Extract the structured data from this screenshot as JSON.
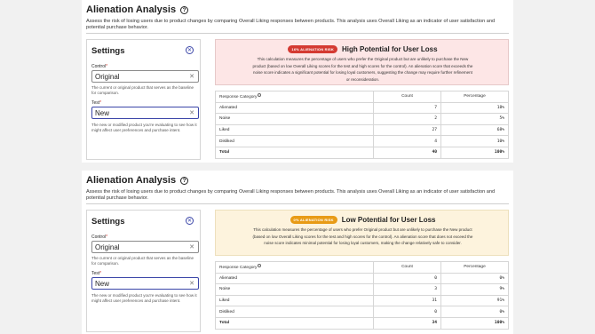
{
  "panels": [
    {
      "title": "Alienation Analysis",
      "description": "Assess the risk of losing users due to product changes by comparing Overall Liking responses between products. This analysis uses Overall Liking as an indicator of user satisfaction and potential purchase behavior.",
      "settings": {
        "title": "Settings",
        "control_label": "Control",
        "control_value": "Original",
        "control_hint": "The current or original product that serves as the baseline for comparison.",
        "test_label": "Test",
        "test_value": "New",
        "test_hint": "The new or modified product you're evaluating to see how it might affect user preferences and purchase intent."
      },
      "result": {
        "badge": "16% ALIENATION RISK",
        "headline": "High Potential for User Loss",
        "text": "This calculation measures the percentage of users who prefer the Original product but are unlikely to purchase the New product (based on low Overall Liking scores for the test and high scores for the control). An alienation score that exceeds the noise score indicates a significant potential for losing loyal customers, suggesting the change may require further refinement or reconsideration."
      },
      "table": {
        "headers": [
          "Response Category",
          "Count",
          "Percentage"
        ],
        "rows": [
          {
            "category": "Alienated",
            "count": "7",
            "pct": "18%"
          },
          {
            "category": "Noise",
            "count": "2",
            "pct": "5%"
          },
          {
            "category": "Liked",
            "count": "27",
            "pct": "68%"
          },
          {
            "category": "Disliked",
            "count": "4",
            "pct": "10%"
          },
          {
            "category": "Total",
            "count": "40",
            "pct": "100%"
          }
        ]
      }
    },
    {
      "title": "Alienation Analysis",
      "description": "Assess the risk of losing users due to product changes by comparing Overall Liking responses between products. This analysis uses Overall Liking as an indicator of user satisfaction and potential purchase behavior.",
      "settings": {
        "title": "Settings",
        "control_label": "Control",
        "control_value": "Original",
        "control_hint": "The current or original product that serves as the baseline for comparison.",
        "test_label": "Test",
        "test_value": "New",
        "test_hint": "The new or modified product you're evaluating to see how it might affect user preferences and purchase intent."
      },
      "result": {
        "badge": "0% ALIENATION RISK",
        "headline": "Low Potential for User Loss",
        "text": "This calculation measures the percentage of users who prefer Original product but are unlikely to purchase the New product (based on low Overall Liking scores for the test and high scores for the control). An alienation score that does not exceed the noise score indicates minimal potential for losing loyal customers, making the change relatively safe to consider."
      },
      "table": {
        "headers": [
          "Response Category",
          "Count",
          "Percentage"
        ],
        "rows": [
          {
            "category": "Alienated",
            "count": "0",
            "pct": "0%"
          },
          {
            "category": "Noise",
            "count": "3",
            "pct": "9%"
          },
          {
            "category": "Liked",
            "count": "31",
            "pct": "91%"
          },
          {
            "category": "Disliked",
            "count": "0",
            "pct": "0%"
          },
          {
            "category": "Total",
            "count": "34",
            "pct": "100%"
          }
        ]
      }
    }
  ],
  "colors": {
    "high_badge": "#d43a32",
    "low_badge": "#e89b16",
    "accent": "#3a45a8"
  }
}
